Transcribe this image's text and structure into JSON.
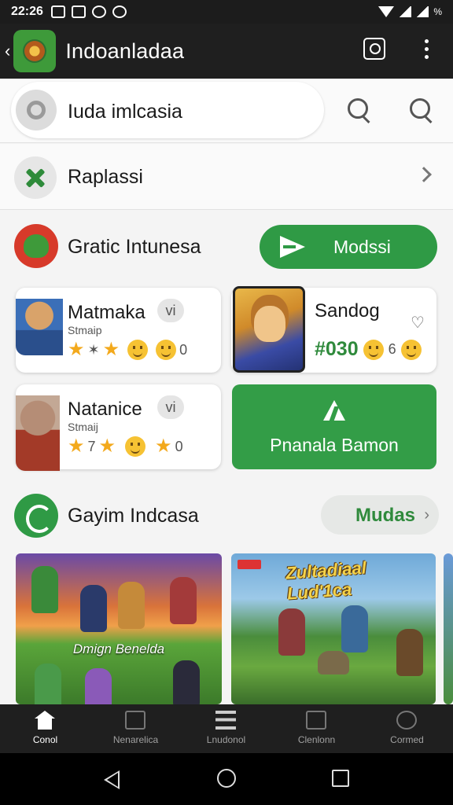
{
  "status_bar": {
    "time": "22:26",
    "right_text": "%"
  },
  "app_bar": {
    "title": "Indoanladaa"
  },
  "search": {
    "text": "Iuda imlcasia"
  },
  "replace_row": {
    "label": "Raplassi"
  },
  "section1": {
    "title": "Gratic Intunesa",
    "button_label": "Modssi"
  },
  "cards": [
    {
      "title": "Matmaka",
      "badge": "vi",
      "subtitle": "Stmaip",
      "count_text": "0"
    },
    {
      "title": "Natanice",
      "badge": "vi",
      "subtitle": "Stmaij",
      "mid_text": "7",
      "count_text": "0"
    }
  ],
  "game_card": {
    "title": "Sandog",
    "code": "#030",
    "num": "6"
  },
  "green_card": {
    "label": "Pnanala Bamon"
  },
  "section2": {
    "title": "Gayim Indcasa",
    "pill_label": "Mudas"
  },
  "banners": [
    {
      "caption": "Dmign Benelda"
    },
    {
      "logo_text": "Zultadiaal Lud'1ca"
    }
  ],
  "bottom_nav": [
    {
      "label": "Conol",
      "icon": "home-icon"
    },
    {
      "label": "Nenarelica",
      "icon": "inbox-icon"
    },
    {
      "label": "Lnudonol",
      "icon": "list-icon"
    },
    {
      "label": "Clenlonn",
      "icon": "document-icon"
    },
    {
      "label": "Cormed",
      "icon": "profile-icon"
    }
  ],
  "colors": {
    "accent_green": "#2f9a45",
    "appbar_bg": "#1f1f1f",
    "star": "#f3a91c"
  }
}
